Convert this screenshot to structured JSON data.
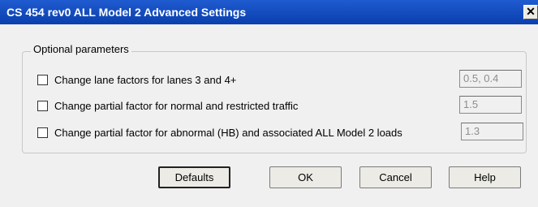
{
  "window": {
    "title": "CS 454 rev0 ALL Model 2 Advanced Settings",
    "close_glyph": "✕"
  },
  "group": {
    "title": "Optional parameters",
    "rows": [
      {
        "label": "Change lane factors for lanes 3 and 4+",
        "checked": false,
        "value": "0.5, 0.4"
      },
      {
        "label": "Change partial factor for normal and restricted traffic",
        "checked": false,
        "value": "1.5"
      },
      {
        "label": "Change partial factor for abnormal (HB) and associated ALL Model 2 loads",
        "checked": false,
        "value": "1.3"
      }
    ]
  },
  "buttons": {
    "defaults": "Defaults",
    "ok": "OK",
    "cancel": "Cancel",
    "help": "Help"
  }
}
